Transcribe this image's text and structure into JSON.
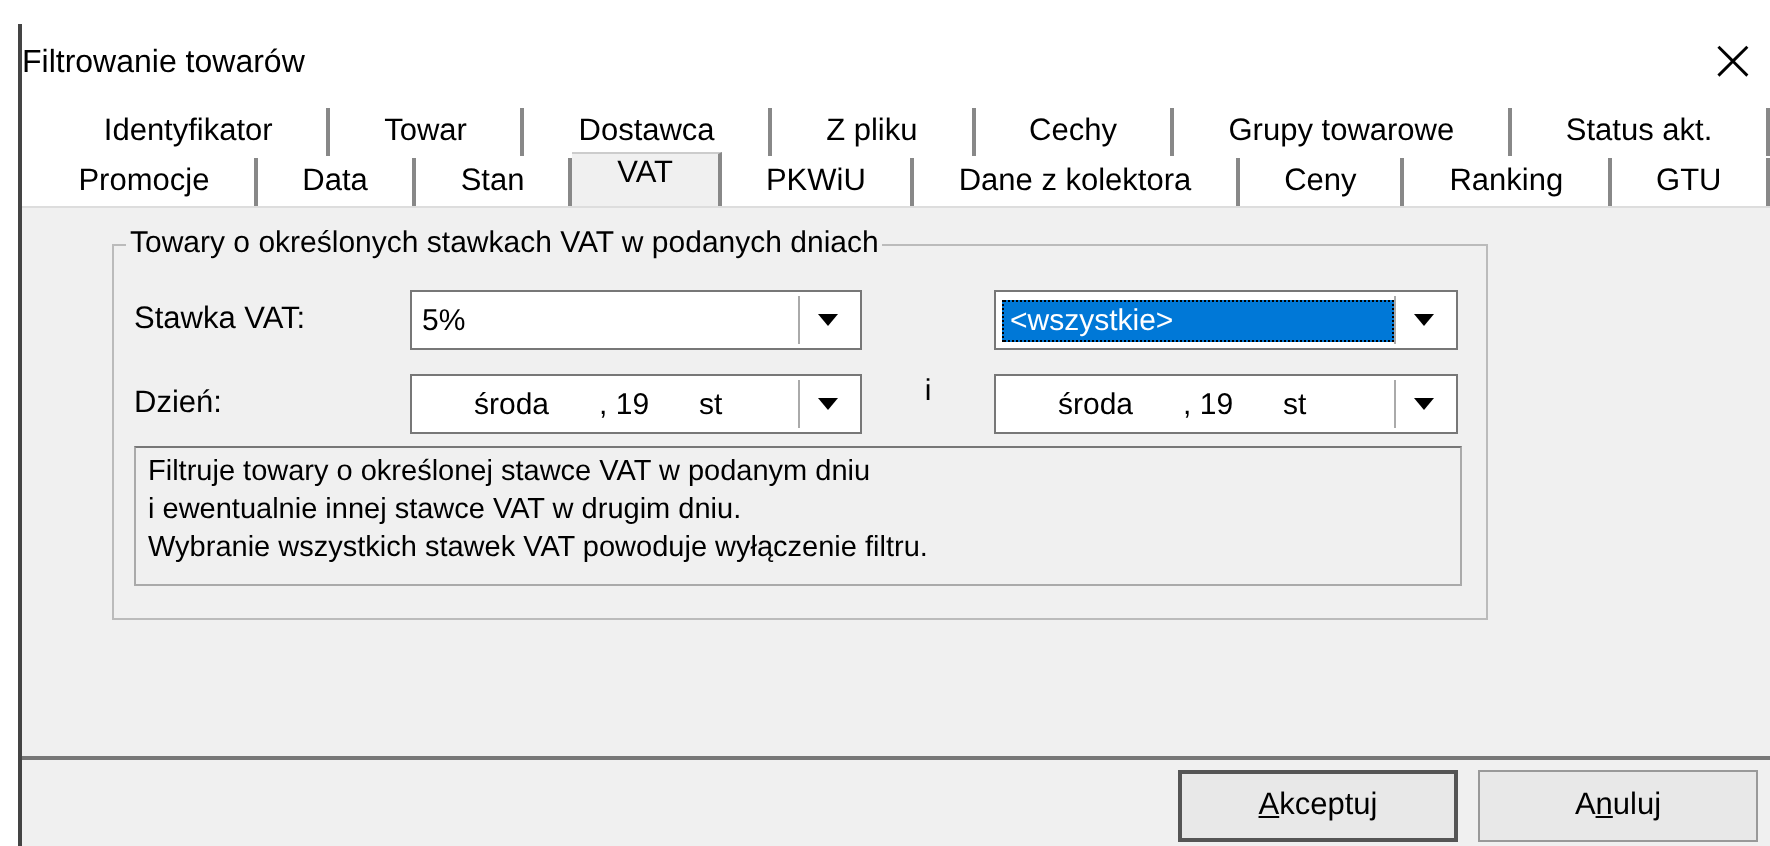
{
  "window": {
    "title": "Filtrowanie towarów",
    "close": "×"
  },
  "tab_rows": [
    [
      {
        "label": "Identyfikator",
        "selected": false
      },
      {
        "label": "Towar",
        "selected": false
      },
      {
        "label": "Dostawca",
        "selected": false
      },
      {
        "label": "Z pliku",
        "selected": false
      },
      {
        "label": "Cechy",
        "selected": false
      },
      {
        "label": "Grupy towarowe",
        "selected": false
      },
      {
        "label": "Status akt.",
        "selected": false
      }
    ],
    [
      {
        "label": "Promocje",
        "selected": false
      },
      {
        "label": "Data",
        "selected": false
      },
      {
        "label": "Stan",
        "selected": false
      },
      {
        "label": "VAT",
        "selected": true
      },
      {
        "label": "PKWiU",
        "selected": false
      },
      {
        "label": "Dane z kolektora",
        "selected": false
      },
      {
        "label": "Ceny",
        "selected": false
      },
      {
        "label": "Ranking",
        "selected": false
      },
      {
        "label": "GTU",
        "selected": false
      }
    ]
  ],
  "group": {
    "title": "Towary o określonych stawkach VAT w podanych dniach",
    "rate_label": "Stawka VAT:",
    "day_label": "Dzień:",
    "and_label": "i",
    "rate_from": {
      "value": "5%",
      "focused": false
    },
    "rate_to": {
      "value": "<wszystkie>",
      "focused": true
    },
    "day_from": {
      "value": "środa      , 19      st"
    },
    "day_to": {
      "value": "środa      , 19      st"
    },
    "description": [
      "Filtruje towary o określonej stawce VAT w podanym dniu",
      "i ewentualnie innej stawce VAT w drugim dniu.",
      "Wybranie wszystkich stawek VAT powoduje wyłączenie filtru."
    ]
  },
  "buttons": [
    {
      "key": "A",
      "after": "kceptuj",
      "default": true
    },
    {
      "before": "A",
      "key": "n",
      "after": "uluj",
      "default": false
    }
  ]
}
